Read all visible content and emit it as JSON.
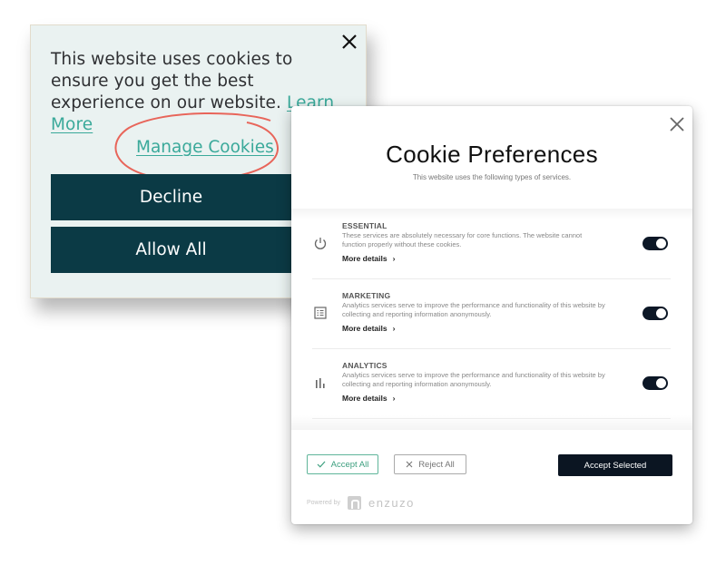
{
  "banner": {
    "message": "This website uses cookies to ensure you get the best experience on our website.",
    "learn_more_link": "Learn More",
    "manage_cookies_link": "Manage Cookies",
    "decline_label": "Decline",
    "allow_all_label": "Allow All",
    "close_icon": "close-icon",
    "colors": {
      "background": "#eaf2f1",
      "button": "#0b3a45",
      "link": "#3aa99a",
      "highlight_circle": "#e8655a"
    }
  },
  "modal": {
    "title": "Cookie Preferences",
    "subtitle": "This website uses the following types of services.",
    "close_icon": "close-icon",
    "categories": [
      {
        "name": "ESSENTIAL",
        "icon": "power-icon",
        "description": "These services are absolutely necessary for core functions. The website cannot function properly without these cookies.",
        "more_details": "More details",
        "enabled": true
      },
      {
        "name": "MARKETING",
        "icon": "list-icon",
        "description": "Analytics services serve to improve the performance and functionality of this website by collecting and reporting information anonymously.",
        "more_details": "More details",
        "enabled": true
      },
      {
        "name": "ANALYTICS",
        "icon": "bar-chart-icon",
        "description": "Analytics services serve to improve the performance and functionality of this website by collecting and reporting information anonymously.",
        "more_details": "More details",
        "enabled": true
      }
    ],
    "accept_all_label": "Accept All",
    "reject_all_label": "Reject All",
    "accept_selected_label": "Accept Selected",
    "powered_by": "Powered by",
    "brand": "enzuzo",
    "colors": {
      "toggle_on": "#0c1726",
      "accept_all": "#3d9f7f",
      "accept_selected_bg": "#0b1522"
    }
  }
}
